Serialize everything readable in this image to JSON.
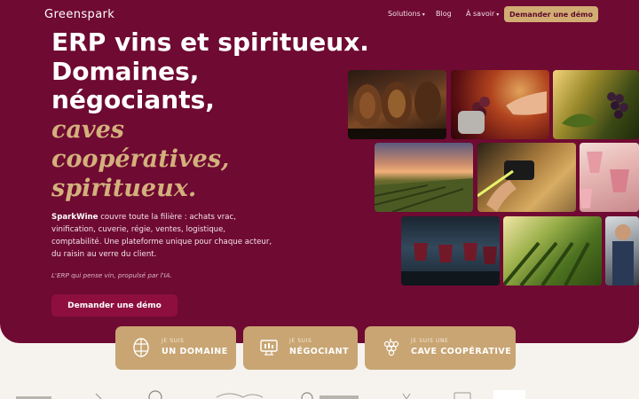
{
  "nav": {
    "logo": "Greenspark",
    "items": [
      {
        "label": "Solutions",
        "dropdown": true
      },
      {
        "label": "Blog",
        "dropdown": false
      },
      {
        "label": "À savoir",
        "dropdown": true
      }
    ],
    "cta": "Demander une démo"
  },
  "hero": {
    "headline_lines": [
      "ERP vins et spiritueux.",
      "Domaines,",
      "négociants,"
    ],
    "headline_accent": [
      "caves",
      "coopératives,",
      "spiritueux."
    ],
    "description_brand": "SparkWine",
    "description_rest": " couvre toute la filière : achats vrac, vinification, cuverie, régie, ventes, logistique, comptabilité. Une plateforme unique pour chaque acteur, du raisin au verre du client.",
    "tagline": "L'ERP qui pense vin, propulsé par l'IA.",
    "cta": "Demander une démo"
  },
  "cards": [
    {
      "small": "JE SUIS",
      "big": "UN DOMAINE",
      "icon": "wine-barrel-icon"
    },
    {
      "small": "JE SUIS",
      "big": "NÉGOCIANT",
      "icon": "monitor-bottles-icon"
    },
    {
      "small": "JE SUIS UNE",
      "big": "CAVE COOPÉRATIVE",
      "icon": "grapes-icon"
    }
  ],
  "photos": [
    {
      "name": "photo-barrels",
      "subject": "wine barrels in cellar"
    },
    {
      "name": "photo-robot-hand",
      "subject": "robot hand holding grapes"
    },
    {
      "name": "photo-grapes-sun",
      "subject": "grape cluster in sunlight"
    },
    {
      "name": "photo-vineyard-sunset",
      "subject": "vineyard at sunset"
    },
    {
      "name": "photo-scanner",
      "subject": "barcode scanner on boxes"
    },
    {
      "name": "photo-rose-glasses",
      "subject": "glasses of rosé wine"
    },
    {
      "name": "photo-wine-glasses",
      "subject": "red wine pouring into glasses"
    },
    {
      "name": "photo-vineyard-rows",
      "subject": "green vineyard rows"
    },
    {
      "name": "photo-phone-vineyard",
      "subject": "hand holding phone in vineyard"
    },
    {
      "name": "photo-person-edge",
      "subject": "person working"
    }
  ],
  "colors": {
    "hero_bg": "#6f0a32",
    "accent_gold": "#d3b07c",
    "card_bg": "#c8a573",
    "page_bg": "#f6f3ef",
    "demo_button": "#8e0f3e"
  }
}
